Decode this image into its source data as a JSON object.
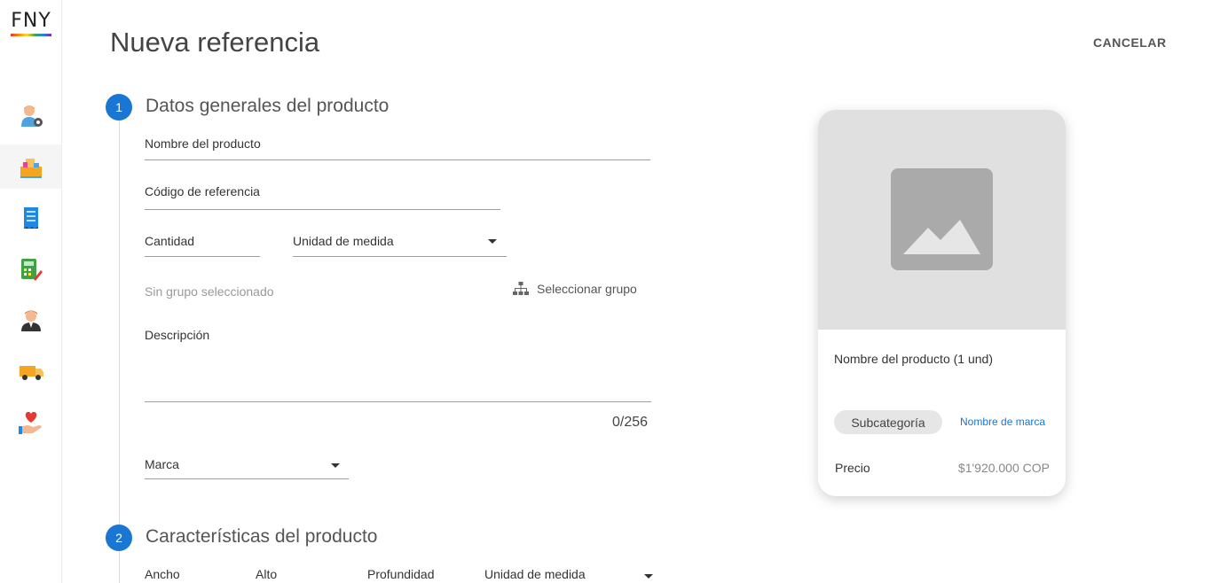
{
  "app": {
    "logo_text": "FNY",
    "nav_items": [
      {
        "icon": "user-settings-icon"
      },
      {
        "icon": "boxes-icon"
      },
      {
        "icon": "receipt-icon"
      },
      {
        "icon": "calculator-icon"
      },
      {
        "icon": "worker-icon"
      },
      {
        "icon": "truck-icon"
      },
      {
        "icon": "heart-hand-icon"
      }
    ]
  },
  "header": {
    "title": "Nueva referencia",
    "cancel_label": "CANCELAR"
  },
  "step1": {
    "number": "1",
    "title": "Datos generales del producto",
    "product_name_label": "Nombre del producto",
    "reference_code_label": "Código de referencia",
    "quantity_label": "Cantidad",
    "unit_label": "Unidad de medida",
    "group_status": "Sin grupo seleccionado",
    "select_group_label": "Seleccionar grupo",
    "description_label": "Descripción",
    "description_counter": "0/256",
    "brand_label": "Marca"
  },
  "step2": {
    "number": "2",
    "title": "Características del producto",
    "width_label": "Ancho",
    "height_label": "Alto",
    "depth_label": "Profundidad",
    "unit_label": "Unidad de medida"
  },
  "preview": {
    "image_icon": "image-placeholder-icon",
    "product_name": "Nombre del producto (1 und)",
    "subcategory": "Subcategoría",
    "brand_name": "Nombre de marca",
    "price_label": "Precio",
    "price_value": "$1'920.000 COP"
  },
  "colors": {
    "accent": "#1976d2",
    "field_line": "#9e9e9e",
    "card_image_bg": "#e0e0e0",
    "placeholder": "#aaaaaa"
  }
}
